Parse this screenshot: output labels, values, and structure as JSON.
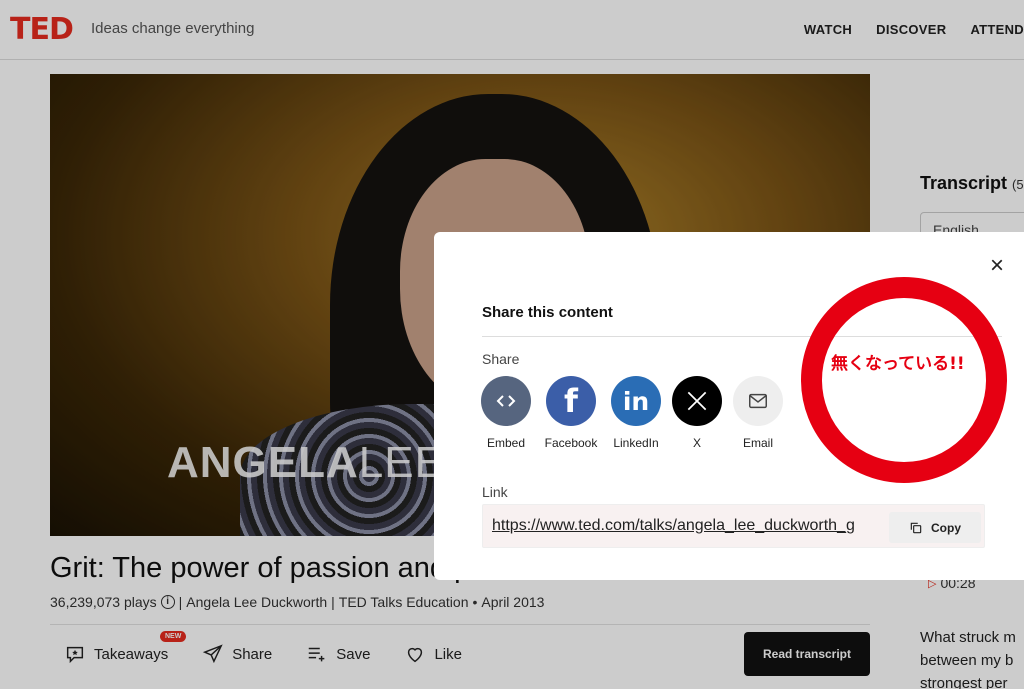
{
  "header": {
    "logo": "TED",
    "tagline": "Ideas change everything",
    "nav": [
      "WATCH",
      "DISCOVER",
      "ATTEND"
    ]
  },
  "video": {
    "speaker_first": "ANGELA",
    "speaker_last": "LEE"
  },
  "talk": {
    "title": "Grit: The power of passion and perseverance",
    "plays": "36,239,073 plays",
    "speaker": "Angela Lee Duckworth",
    "event": "TED Talks Education",
    "date": "April 2013",
    "separator1": "|",
    "separator2": "|",
    "bullet": "•"
  },
  "actions": {
    "takeaways": "Takeaways",
    "new_badge": "NEW",
    "share": "Share",
    "save": "Save",
    "like": "Like",
    "read_transcript": "Read transcript"
  },
  "transcript": {
    "title": "Transcript",
    "count": "(5",
    "language": "English",
    "timestamp": "00:28",
    "text_lines": [
      "What struck m",
      "between my b",
      "strongest per"
    ]
  },
  "modal": {
    "title": "Share this content",
    "share_label": "Share",
    "share_items": [
      {
        "label": "Embed",
        "icon": "embed-icon",
        "color": "#56657f"
      },
      {
        "label": "Facebook",
        "icon": "facebook-icon",
        "color": "#3b5ea8"
      },
      {
        "label": "LinkedIn",
        "icon": "linkedin-icon",
        "color": "#2a6db5"
      },
      {
        "label": "X",
        "icon": "x-icon",
        "color": "#000000"
      },
      {
        "label": "Email",
        "icon": "email-icon",
        "color": "#eeeeee"
      }
    ],
    "link_label": "Link",
    "link_url": "https://www.ted.com/talks/angela_lee_duckworth_g",
    "copy_label": "Copy",
    "close_label": "×"
  },
  "annotation": {
    "text": "無くなっている!!",
    "color": "#e60012"
  },
  "colors": {
    "ted_red": "#e62b1e"
  }
}
